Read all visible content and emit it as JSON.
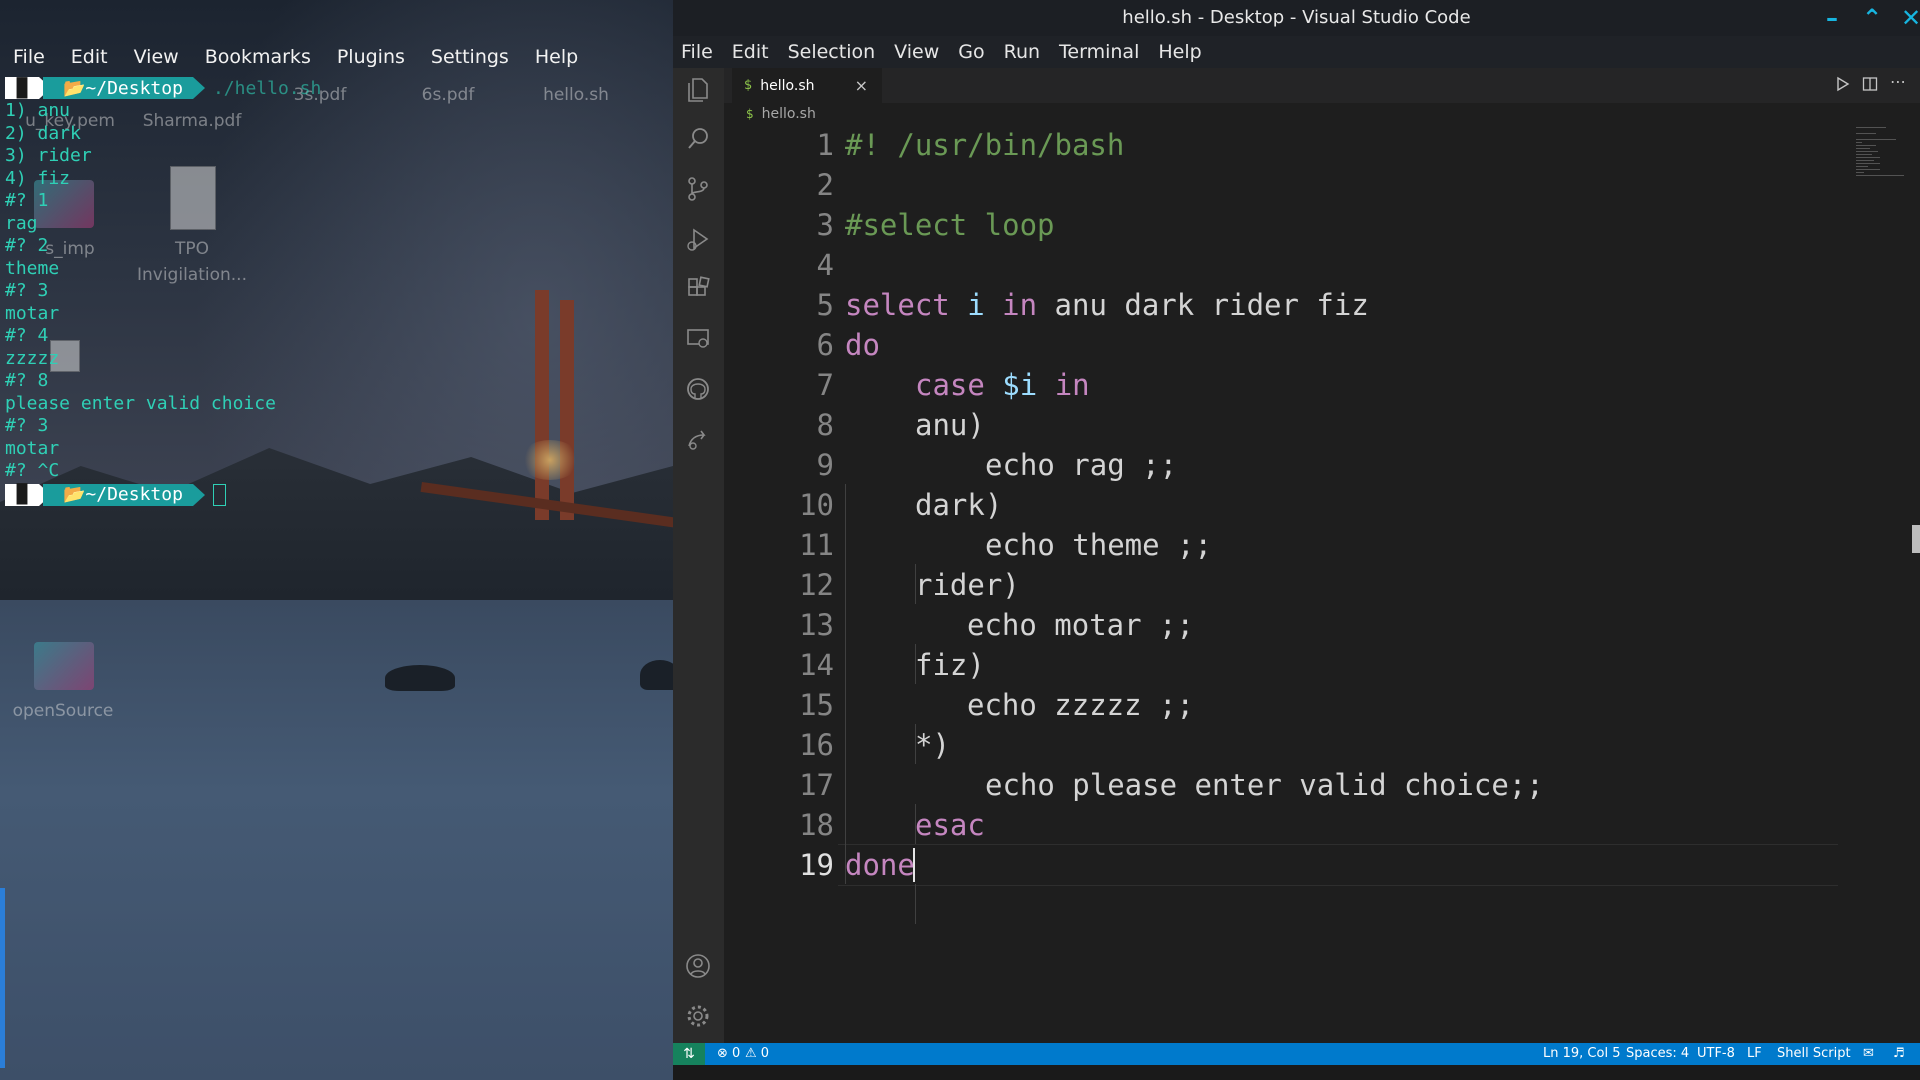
{
  "terminal": {
    "menu": [
      "File",
      "Edit",
      "View",
      "Bookmarks",
      "Plugins",
      "Settings",
      "Help"
    ],
    "prompt_icon": "▐▌",
    "prompt_dir": "📂~/Desktop",
    "first_command": "./hello.sh",
    "lines": [
      "1) anu",
      "2) dark",
      "3) rider",
      "4) fiz",
      "#? 1",
      "rag",
      "#? 2",
      "theme",
      "#? 3",
      "motar",
      "#? 4",
      "zzzzz",
      "#? 8",
      "please enter valid choice",
      "#? 3",
      "motar",
      "#? ^C"
    ]
  },
  "desktop": {
    "icons": {
      "key_pem": "u_key.pem",
      "sharma": "Sharma.pdf",
      "s3": "3s.pdf",
      "s6": "6s.pdf",
      "hello": "hello.sh",
      "simp": "s_imp",
      "tpo": "TPO\nInvigilation...",
      "opensource": "openSource"
    }
  },
  "vscode": {
    "title": "hello.sh - Desktop - Visual Studio Code",
    "menu": [
      "File",
      "Edit",
      "Selection",
      "View",
      "Go",
      "Run",
      "Terminal",
      "Help"
    ],
    "tab": {
      "icon": "$",
      "name": "hello.sh",
      "close": "×"
    },
    "breadcrumb": {
      "icon": "$",
      "name": "hello.sh"
    },
    "line_numbers": [
      "1",
      "2",
      "3",
      "4",
      "5",
      "6",
      "7",
      "8",
      "9",
      "10",
      "11",
      "12",
      "13",
      "14",
      "15",
      "16",
      "17",
      "18",
      "19"
    ],
    "code": {
      "l1": "#! /usr/bin/bash",
      "l3": "#select loop",
      "l5_kw1": "select",
      "l5_var": " i ",
      "l5_kw2": "in",
      "l5_rest": " anu dark rider fiz",
      "l6": "do",
      "l7_kw1": "case",
      "l7_var": " $i ",
      "l7_kw2": "in",
      "l8": "anu)",
      "l9": "echo rag ;;",
      "l10": "dark)",
      "l11": "echo theme ;;",
      "l12": "rider)",
      "l13": "echo motar ;;",
      "l14": "fiz)",
      "l15": "echo zzzzz ;;",
      "l16": "*)",
      "l17": "echo please enter valid choice;;",
      "l18": "esac",
      "l19": "done"
    },
    "status": {
      "errors": "⊗ 0",
      "warnings": "⚠ 0",
      "position": "Ln 19, Col 5",
      "spaces": "Spaces: 4",
      "encoding": "UTF-8",
      "eol": "LF",
      "language": "Shell Script"
    },
    "colors": {
      "keyword": "#c586c0",
      "comment": "#6a9955",
      "variable": "#9cdcfe",
      "statusbar": "#007acc",
      "terminal_text": "#2fd0b6"
    }
  }
}
